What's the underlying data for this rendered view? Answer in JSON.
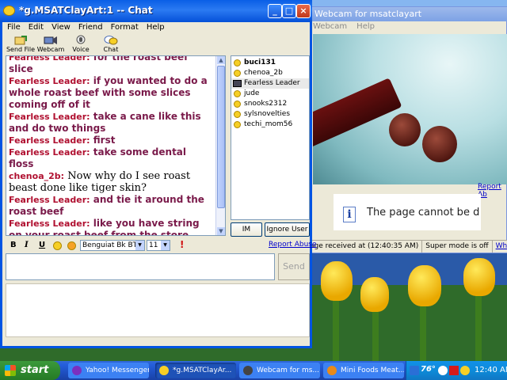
{
  "webcam_window": {
    "title": "Webcam for msatclayart",
    "menu": [
      "Webcam",
      "Help"
    ],
    "report_link": "Report Ab",
    "error_message": "The page cannot be d",
    "status": {
      "received": "age received at (12:40:35 AM)",
      "super_mode": "Super mode is off",
      "whats": "What's t"
    }
  },
  "chat_window": {
    "title": "*g.MSATClayArt:1 -- Chat",
    "menu": [
      "File",
      "Edit",
      "View",
      "Friend",
      "Format",
      "Help"
    ],
    "toolbar": [
      {
        "label": "Send File",
        "icon": "send-file-icon"
      },
      {
        "label": "Webcam",
        "icon": "webcam-icon"
      },
      {
        "label": "Voice",
        "icon": "voice-icon"
      },
      {
        "label": "Chat",
        "icon": "chat-icon"
      }
    ],
    "messages": [
      {
        "sender": "Fearless Leader:",
        "text": "for the roast beef slice",
        "style": "leader"
      },
      {
        "sender": "Fearless Leader:",
        "text": "if you wanted to do a whole roast beef with some slices coming off of it",
        "style": "leader"
      },
      {
        "sender": "Fearless Leader:",
        "text": "take a cane like this and do two things",
        "style": "leader"
      },
      {
        "sender": "Fearless Leader:",
        "text": "first",
        "style": "leader"
      },
      {
        "sender": "Fearless Leader:",
        "text": "take some dental floss",
        "style": "leader"
      },
      {
        "sender": "chenoa_2b:",
        "text": "Now why do I see roast beast done like tiger skin?",
        "style": "chenoa"
      },
      {
        "sender": "Fearless Leader:",
        "text": "and tie it around the roast beef",
        "style": "leader"
      },
      {
        "sender": "Fearless Leader:",
        "text": "like you have string on your roast beef from the store",
        "style": "leader"
      }
    ],
    "users": [
      {
        "name": "buci131",
        "bold": true,
        "badge": "smiley"
      },
      {
        "name": "chenoa_2b",
        "bold": false,
        "badge": "smiley"
      },
      {
        "name": "Fearless Leader",
        "bold": false,
        "badge": "webcam",
        "selected": true
      },
      {
        "name": "jude",
        "bold": false,
        "badge": "smiley"
      },
      {
        "name": "snooks2312",
        "bold": false,
        "badge": "smiley"
      },
      {
        "name": "sylsnovelties",
        "bold": false,
        "badge": "smiley"
      },
      {
        "name": "techi_mom56",
        "bold": false,
        "badge": "smiley"
      }
    ],
    "buttons": {
      "im": "IM",
      "ignore": "Ignore User",
      "send": "Send"
    },
    "format": {
      "bold": "B",
      "italic": "I",
      "underline": "U",
      "font": "Benguiat Bk BT",
      "size": "11"
    },
    "report_abuse": "Report Abuse",
    "message_input": ""
  },
  "taskbar": {
    "start": "start",
    "tasks": [
      {
        "label": "Yahoo! Messenger",
        "active": false
      },
      {
        "label": "*g.MSATClayAr...",
        "active": true
      },
      {
        "label": "Webcam for ms...",
        "active": false
      },
      {
        "label": "Mini Foods Meat...",
        "active": false
      }
    ],
    "tray_temp": "76°",
    "clock": "12:40 AM"
  }
}
